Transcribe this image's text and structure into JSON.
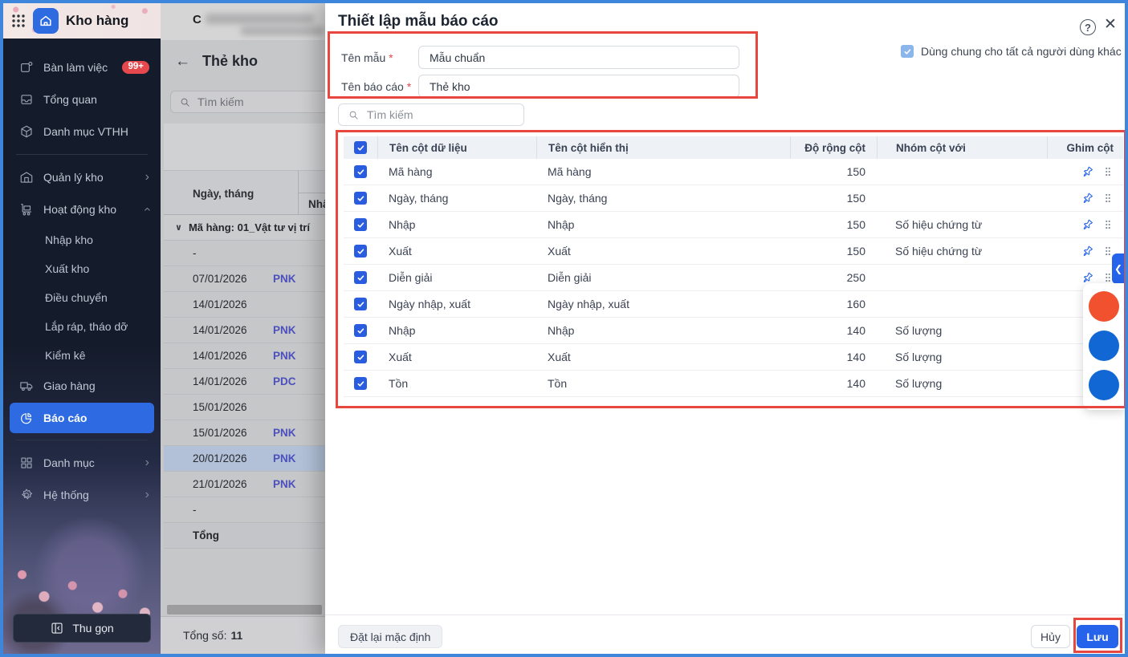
{
  "app": {
    "title": "Kho hàng",
    "company_prefix": "C"
  },
  "colors": {
    "accent": "#2563eb",
    "annotation": "#e8473f",
    "badge": "#e5484d",
    "sidebar_active": "#2e6be2"
  },
  "sidebar": {
    "groups": [
      {
        "items": [
          {
            "name": "ban-lam-viec",
            "icon": "desk",
            "label": "Bàn làm việc",
            "badge": "99+"
          },
          {
            "name": "tong-quan",
            "icon": "inbox",
            "label": "Tổng quan"
          },
          {
            "name": "danh-muc-vthh",
            "icon": "cube",
            "label": "Danh mục VTHH"
          }
        ]
      },
      {
        "items": [
          {
            "name": "quan-ly-kho",
            "icon": "warehouse",
            "label": "Quản lý kho",
            "chevron": "right"
          },
          {
            "name": "hoat-dong-kho",
            "icon": "trolley",
            "label": "Hoạt động kho",
            "chevron": "up"
          },
          {
            "name": "nhap-kho",
            "label": "Nhập kho",
            "sub": true
          },
          {
            "name": "xuat-kho",
            "label": "Xuất kho",
            "sub": true
          },
          {
            "name": "dieu-chuyen",
            "label": "Điều chuyển",
            "sub": true
          },
          {
            "name": "lap-rap-thao-do",
            "label": "Lắp ráp, tháo dỡ",
            "sub": true
          },
          {
            "name": "kiem-ke",
            "label": "Kiểm kê",
            "sub": true
          },
          {
            "name": "giao-hang",
            "icon": "truck",
            "label": "Giao hàng"
          },
          {
            "name": "bao-cao",
            "icon": "pie",
            "label": "Báo cáo",
            "active": true
          }
        ]
      },
      {
        "items": [
          {
            "name": "danh-muc",
            "icon": "grid",
            "label": "Danh mục",
            "chevron": "right"
          },
          {
            "name": "he-thong",
            "icon": "gear",
            "label": "Hệ thống",
            "chevron": "right"
          }
        ]
      }
    ],
    "collapse_label": "Thu gọn"
  },
  "content": {
    "back_glyph": "←",
    "page_title": "Thẻ kho",
    "search_placeholder": "Tìm kiếm",
    "table": {
      "col_date": "Ngày, tháng",
      "col_doc_partial": "Nhậ",
      "group_chevron": "∨",
      "group_label": "Mã hàng: 01_Vật tư vị trí",
      "rows": [
        {
          "date": "-",
          "doc": ""
        },
        {
          "date": "07/01/2026",
          "doc": "PNK"
        },
        {
          "date": "14/01/2026",
          "doc": ""
        },
        {
          "date": "14/01/2026",
          "doc": "PNK"
        },
        {
          "date": "14/01/2026",
          "doc": "PNK"
        },
        {
          "date": "14/01/2026",
          "doc": "PDC"
        },
        {
          "date": "15/01/2026",
          "doc": ""
        },
        {
          "date": "15/01/2026",
          "doc": "PNK"
        },
        {
          "date": "20/01/2026",
          "doc": "PNK",
          "selected": true
        },
        {
          "date": "21/01/2026",
          "doc": "PNK"
        },
        {
          "date": "-",
          "doc": ""
        }
      ],
      "total_label": "Tổng"
    },
    "footer": {
      "total_label": "Tổng số:",
      "total_value": "11"
    }
  },
  "modal": {
    "title": "Thiết lập mẫu báo cáo",
    "help_glyph": "?",
    "close_glyph": "✕",
    "required_marker": "*",
    "fields": {
      "template_name": {
        "label": "Tên mẫu",
        "value": "Mẫu chuẩn"
      },
      "report_name": {
        "label": "Tên báo cáo",
        "value": "Thẻ kho"
      }
    },
    "share_checkbox_label": "Dùng chung cho tất cả người dùng khác",
    "search_placeholder": "Tìm kiếm",
    "table": {
      "headers": [
        "Tên cột dữ liệu",
        "Tên cột hiển thị",
        "Độ rộng cột",
        "Nhóm cột với",
        "Ghim cột"
      ],
      "rows": [
        {
          "data_name": "Mã hàng",
          "display_name": "Mã hàng",
          "width": "150",
          "group": ""
        },
        {
          "data_name": "Ngày, tháng",
          "display_name": "Ngày, tháng",
          "width": "150",
          "group": ""
        },
        {
          "data_name": "Nhập",
          "display_name": "Nhập",
          "width": "150",
          "group": "Số hiệu chứng từ"
        },
        {
          "data_name": "Xuất",
          "display_name": "Xuất",
          "width": "150",
          "group": "Số hiệu chứng từ"
        },
        {
          "data_name": "Diễn giải",
          "display_name": "Diễn giải",
          "width": "250",
          "group": ""
        },
        {
          "data_name": "Ngày nhập, xuất",
          "display_name": "Ngày nhập, xuất",
          "width": "160",
          "group": ""
        },
        {
          "data_name": "Nhập",
          "display_name": "Nhập",
          "width": "140",
          "group": "Số lượng"
        },
        {
          "data_name": "Xuất",
          "display_name": "Xuất",
          "width": "140",
          "group": "Số lượng"
        },
        {
          "data_name": "Tồn",
          "display_name": "Tồn",
          "width": "140",
          "group": "Số lượng"
        }
      ]
    },
    "footer": {
      "reset_label": "Đặt lại mặc định",
      "cancel_label": "Hủy",
      "save_label": "Lưu"
    }
  },
  "fab": {
    "collapse_glyph": "❮",
    "buttons": [
      {
        "name": "ai-assistant",
        "icon": "sparkle",
        "color": "#f1512f"
      },
      {
        "name": "chat-support",
        "icon": "chat",
        "color": "#1168d4"
      },
      {
        "name": "help-tips",
        "icon": "bulb",
        "color": "#1168d4"
      }
    ]
  }
}
